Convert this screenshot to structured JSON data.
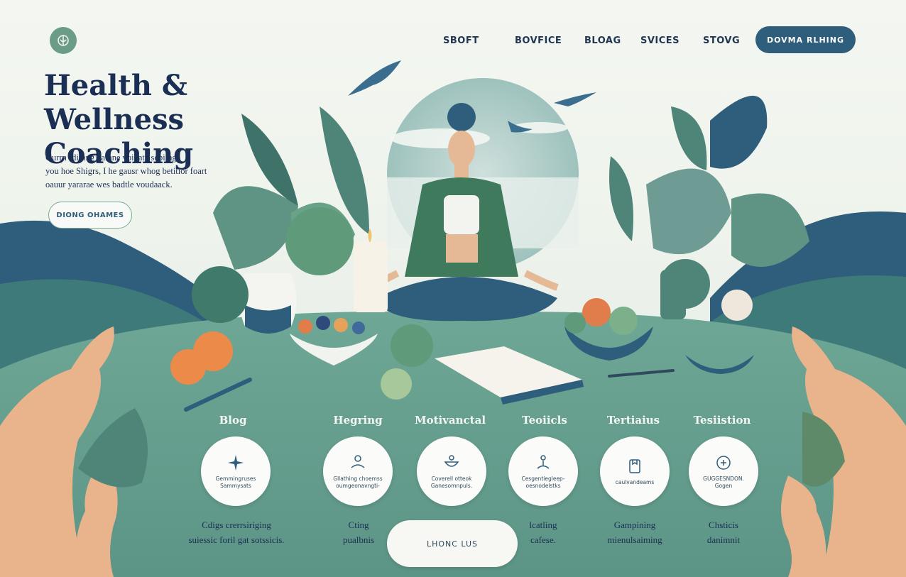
{
  "header": {
    "logo_icon": "lotus-icon",
    "nav": [
      "SBOFT",
      "BOVFICE",
      "BLOAG",
      "SVICES",
      "STOVG"
    ],
    "cta_label": "DOVMA RLHING"
  },
  "hero": {
    "title_line1": "Health & Wellness",
    "title_line2": "Coaching",
    "desc_line1": "Ourrn fdirang varane voikata sebiing.",
    "desc_line2": "you hoe Shigrs, I he gausr whog betitior foart",
    "desc_line3": "oauur yararae wes badtle voudaack.",
    "button_label": "DIONG OHAMES"
  },
  "services": [
    {
      "title": "Blog",
      "icon": "star-icon",
      "circle_line1": "Gemmingruses",
      "circle_line2": "Sammysats",
      "caption_line1": "Cdigs crerrsiriging",
      "caption_line2": "suiessic foril gat sotssicis."
    },
    {
      "title": "Hegring",
      "icon": "meditation-icon",
      "circle_line1": "Gllathing choemss",
      "circle_line2": "oumgeonavngti-",
      "caption_line1": "Cting",
      "caption_line2": "pualbnis"
    },
    {
      "title": "Motivanctal",
      "icon": "bowl-icon",
      "circle_line1": "Coverell otteok",
      "circle_line2": "Ganesomnpuls.",
      "caption_line1": "",
      "caption_line2": ""
    },
    {
      "title": "Teoiicls",
      "icon": "yoga-icon",
      "circle_line1": "Cesgentiegleep-",
      "circle_line2": "oesnodelstks",
      "caption_line1": "lcatling",
      "caption_line2": "cafese."
    },
    {
      "title": "Tertiaius",
      "icon": "journal-icon",
      "circle_line1": "caulvandeams",
      "circle_line2": "",
      "caption_line1": "Gampining",
      "caption_line2": "mienulsaiming"
    },
    {
      "title": "Tesiistion",
      "icon": "scale-icon",
      "circle_line1": "GUGGESNDON.",
      "circle_line2": "Gogen",
      "caption_line1": "Chsticis",
      "caption_line2": "danimnit"
    }
  ],
  "bottom_button": "LHONC LUS",
  "colors": {
    "primary": "#2f5d7c",
    "heading": "#1b2f55",
    "sage": "#6a9c86",
    "teal_ground": "#5f9a8c"
  }
}
